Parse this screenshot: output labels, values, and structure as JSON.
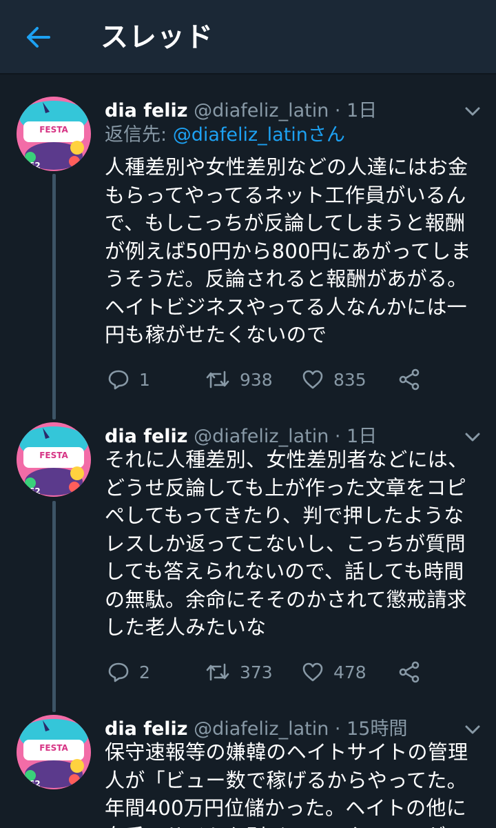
{
  "header": {
    "title": "スレッド",
    "back_icon": "back-arrow-icon",
    "accent": "#1da1f2"
  },
  "tweets": [
    {
      "name": "dia feliz",
      "handle": "@diafeliz_latin",
      "time": "· 1日",
      "reply_prefix": "返信先: ",
      "reply_to": "@diafeliz_latinさん",
      "text": "人種差別や女性差別などの人達にはお金\nもらってやってるネット工作員がいるん\nで、もしこっちが反論してしまうと報酬\nが例えば50円から800円にあがってしま\nうそうだ。反論されると報酬があがる。\nヘイトビジネスやってる人なんかには一\n円も稼がせたくないので",
      "replies": "1",
      "retweets": "938",
      "likes": "835"
    },
    {
      "name": "dia feliz",
      "handle": "@diafeliz_latin",
      "time": "· 1日",
      "text": "それに人種差別、女性差別者などには、\nどうせ反論しても上が作った文章をコピ\nペしてもってきたり、判で押したような\nレスしか返ってこないし、こっちが質問\nしても答えられないので、話しても時間\nの無駄。余命にそそのかされて懲戒請求\nした老人みたいな",
      "replies": "2",
      "retweets": "373",
      "likes": "478"
    },
    {
      "name": "dia feliz",
      "handle": "@diafeliz_latin",
      "time": "· 15時間",
      "text": "保守速報等の嫌韓のヘイトサイトの管理\n人が「ビュー数で稼げるからやってた。\n年間400万円位儲かった。ヘイトの他に\n女系のサイトも別ジャンルやってるが"
    }
  ],
  "colors": {
    "background": "#141d26",
    "header": "#1b2836",
    "secondary_text": "#8899a6",
    "thread_line": "#3d5466"
  }
}
